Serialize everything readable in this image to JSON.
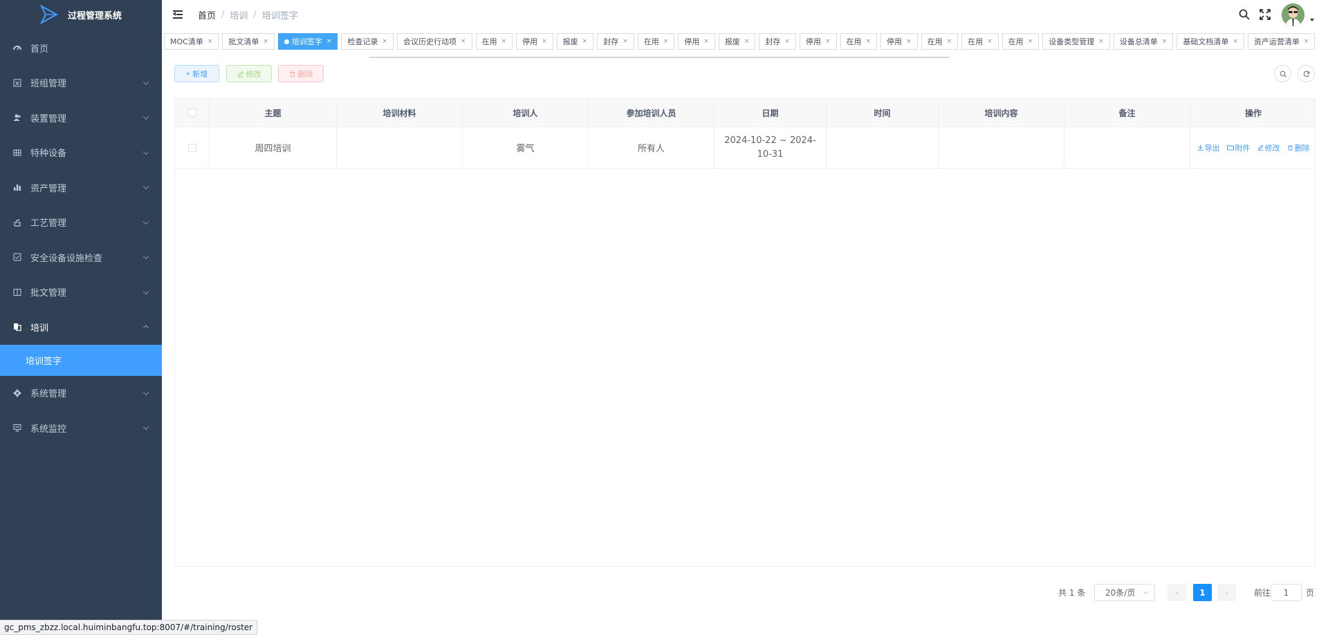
{
  "app": {
    "title": "过程管理系统"
  },
  "sidebar": {
    "items": [
      {
        "label": "首页",
        "icon": "dashboard-icon",
        "hasChildren": false
      },
      {
        "label": "班组管理",
        "icon": "team-icon",
        "hasChildren": true
      },
      {
        "label": "装置管理",
        "icon": "user-icon",
        "hasChildren": true
      },
      {
        "label": "特种设备",
        "icon": "grid-icon",
        "hasChildren": true
      },
      {
        "label": "资产管理",
        "icon": "chart-icon",
        "hasChildren": true
      },
      {
        "label": "工艺管理",
        "icon": "process-icon",
        "hasChildren": true
      },
      {
        "label": "安全设备设施检查",
        "icon": "check-icon",
        "hasChildren": true
      },
      {
        "label": "批文管理",
        "icon": "book-icon",
        "hasChildren": true
      },
      {
        "label": "培训",
        "icon": "training-icon",
        "hasChildren": true,
        "open": true
      },
      {
        "label": "系统管理",
        "icon": "gear-icon",
        "hasChildren": true
      },
      {
        "label": "系统监控",
        "icon": "monitor-icon",
        "hasChildren": true
      }
    ],
    "active_sub": "培训签字"
  },
  "breadcrumb": {
    "home": "首页",
    "parent": "培训",
    "current": "培训签字",
    "sep": "/"
  },
  "tags": [
    "MOC清单",
    "批文清单",
    "培训签字",
    "检查记录",
    "会议历史行动项",
    "在用",
    "停用",
    "报废",
    "封存",
    "在用",
    "停用",
    "报废",
    "封存",
    "停用",
    "在用",
    "停用",
    "在用",
    "在用",
    "在用",
    "设备类型管理",
    "设备总清单",
    "基础文档清单",
    "资产运营清单"
  ],
  "active_tag": "培训签字",
  "toolbar": {
    "add": "新增",
    "edit": "修改",
    "delete": "删除"
  },
  "table": {
    "columns": [
      "主题",
      "培训材料",
      "培训人",
      "参加培训人员",
      "日期",
      "时间",
      "培训内容",
      "备注",
      "操作"
    ],
    "rows": [
      {
        "subject": "周四培训",
        "material": "",
        "trainer": "雾气",
        "attendees": "所有人",
        "date": "2024-10-22 ~ 2024-10-31",
        "time": "",
        "content": "",
        "remark": ""
      }
    ],
    "actions": {
      "export": "导出",
      "attach": "附件",
      "edit": "修改",
      "delete": "删除"
    }
  },
  "pagination": {
    "total_label": "共 1 条",
    "page_size": "20条/页",
    "current_page": "1",
    "goto_label": "前往",
    "goto_value": "1",
    "page_suffix": "页"
  },
  "statusbar": {
    "url": "gc_pms_zbzz.local.huiminbangfu.top:8007/#/training/roster"
  }
}
